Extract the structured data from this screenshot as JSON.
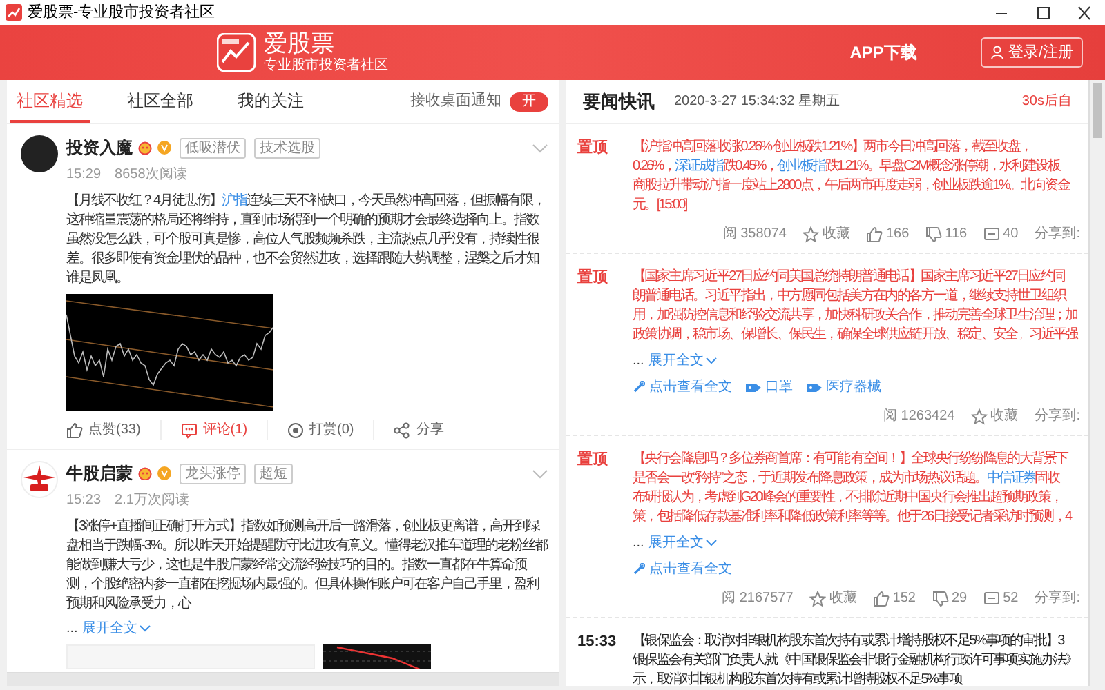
{
  "window": {
    "title": "爱股票-专业股市投资者社区"
  },
  "header": {
    "brand": "爱股票",
    "tagline": "专业股市投资者社区",
    "app_download": "APP下载",
    "login_button": "登录/注册"
  },
  "community": {
    "tabs": [
      {
        "label": "社区精选",
        "selected": true
      },
      {
        "label": "社区全部",
        "selected": false
      },
      {
        "label": "我的关注",
        "selected": false
      }
    ],
    "notify_label": "接收桌面通知",
    "notify_toggle": {
      "label": "开",
      "on": true
    }
  },
  "posts": [
    {
      "author": "投资入魔",
      "avatar": {
        "kind": "photo"
      },
      "tags": [
        "低吸潜伏",
        "技术选股"
      ],
      "time": "15:29",
      "reads": "8658次阅读",
      "text": [
        {
          "text": "【月线不收红？4月徒悲伤】",
          "link": false
        },
        {
          "text": "沪指",
          "link": true
        },
        {
          "text": "连续三天不补缺口，今天虽然冲高回落，但振幅有限，这种缩量震荡的格局还将维持，直到市场得到一个明确的预期才会最终选择向上。指数虽然没怎么跌，可个股可真是惨，高位人气股频频杀跌，主流热点几乎没有，持续性很差。很多即使有资金埋伏的品种，也不会贸然进攻，选择跟随大势调整，涅槃之后才知谁是凤凰。",
          "link": false
        }
      ],
      "media": [
        {
          "kind": "chart"
        }
      ],
      "actions": [
        {
          "kind": "like",
          "label": "点赞(33)",
          "active": false
        },
        {
          "kind": "comment",
          "label": "评论(1)",
          "active": true
        },
        {
          "kind": "reward",
          "label": "打赏(0)",
          "active": false
        },
        {
          "kind": "share",
          "label": "分享",
          "active": false
        }
      ]
    },
    {
      "author": "牛股启蒙",
      "avatar": {
        "kind": "logo"
      },
      "tags": [
        "龙头涨停",
        "超短"
      ],
      "time": "15:23",
      "reads": "2.1万次阅读",
      "text": [
        {
          "text": "【3涨停+直播间正确打开方式】指数如预测高开后一路滑落，创业板更离谱，高开到绿盘相当于跌幅-3%。所以昨天开始提醒防守比进攻有意义。懂得老汉推车道理的老粉丝都能做到赚大亏少，这也是牛股启蒙经常交流经验技巧的目的。指数一直都在牛算命预测，个股绝密内参一直都在挖掘场内最强的。但具体操作账户可在客户自己手里，盈利预期和风险承受力，心",
          "link": false
        }
      ],
      "ellipsis": "...",
      "expand": "展开全文",
      "media": [
        {
          "kind": "screenshot"
        },
        {
          "kind": "chart_thumb"
        }
      ]
    }
  ],
  "news": {
    "title": "要闻快讯",
    "datetime": "2020-3-27 15:34:32 星期五",
    "refresh": "30s后自",
    "items": [
      {
        "badge": "置顶",
        "pinned": true,
        "lines": [
          [
            {
              "text": "【沪指冲高回落收涨0.26% 创业板跌1.21%】两市今日冲高回落，截至收盘，",
              "link": false
            }
          ],
          [
            {
              "text": "0.26%，",
              "link": false
            },
            {
              "text": "深证成指",
              "link": true
            },
            {
              "text": "跌0.45%，",
              "link": false
            },
            {
              "text": "创业板指",
              "link": true
            },
            {
              "text": "跌1.21%。早盘C2M概念涨停潮，水利建设板",
              "link": false
            }
          ],
          [
            {
              "text": "商股拉升带动沪指一度站上2800点，午后两市再度走弱，创业板跌逾1%。北向资金",
              "link": false
            }
          ],
          [
            {
              "text": "元。[15:00]",
              "link": false
            }
          ]
        ],
        "stats": [
          {
            "kind": "views",
            "label": "阅 358074"
          },
          {
            "kind": "favorite",
            "label": "收藏"
          },
          {
            "kind": "like",
            "label": "166"
          },
          {
            "kind": "dislike",
            "label": "116"
          },
          {
            "kind": "comment",
            "label": "40"
          },
          {
            "kind": "share",
            "label": "分享到:"
          }
        ]
      },
      {
        "badge": "置顶",
        "pinned": true,
        "lines": [
          [
            {
              "text": "【国家主席习近平27日应约同美国总统特朗普通电话】国家主席习近平27日应约同",
              "link": false
            }
          ],
          [
            {
              "text": "朗普通电话。习近平指出，中方愿同包括美方在内的各方一道，继续支持世卫组织",
              "link": false
            }
          ],
          [
            {
              "text": "用，加强防控信息和经验交流共享，加快科研攻关合作，推动完善全球卫生治理；加",
              "link": false
            }
          ],
          [
            {
              "text": "政策协调，稳市场、保增长、保民生，确保全球供应链开放、稳定、安全。习近平强",
              "link": false
            }
          ]
        ],
        "ellipsis": "...",
        "expand": "展开全文",
        "links": [
          {
            "kind": "full",
            "label": "点击查看全文"
          },
          {
            "kind": "tag",
            "label": "口罩"
          },
          {
            "kind": "tag",
            "label": "医疗器械"
          }
        ],
        "stats": [
          {
            "kind": "views",
            "label": "阅 1263424"
          },
          {
            "kind": "favorite",
            "label": "收藏"
          },
          {
            "kind": "share",
            "label": "分享到:"
          }
        ]
      },
      {
        "badge": "置顶",
        "pinned": true,
        "lines": [
          [
            {
              "text": "【央行会降息吗？多位券商首席：有可能 有空间！】全球央行纷纷降息的大背景下",
              "link": false
            }
          ],
          [
            {
              "text": "是否会一改“矜持”之态，于近期发布降息政策，成为市场热议话题。",
              "link": false
            },
            {
              "text": "中信证券",
              "link": true
            },
            {
              "text": "固收",
              "link": false
            }
          ],
          [
            {
              "text": "布研报认为，考虑到G20峰会的重要性，不排除近期中国央行会推出超预期政策，",
              "link": false
            }
          ],
          [
            {
              "text": "策，包括降低存款基准利率和降低政策利率等等。他于26日接受记者采访时预测，4",
              "link": false
            }
          ]
        ],
        "ellipsis": "...",
        "expand": "展开全文",
        "links": [
          {
            "kind": "full",
            "label": "点击查看全文"
          }
        ],
        "stats": [
          {
            "kind": "views",
            "label": "阅 2167577"
          },
          {
            "kind": "favorite",
            "label": "收藏"
          },
          {
            "kind": "like",
            "label": "152"
          },
          {
            "kind": "dislike",
            "label": "29"
          },
          {
            "kind": "comment",
            "label": "52"
          },
          {
            "kind": "share",
            "label": "分享到:"
          }
        ]
      },
      {
        "badge": "15:33",
        "pinned": false,
        "lines": [
          [
            {
              "text": "【银保监会：取消对非银机构股东首次持有或累计增持股权不足5%事项的审批】3",
              "link": false
            }
          ],
          [
            {
              "text": "银保监会有关部门负责人就《中国银保监会非银行金融机构行政许可事项实施办法》",
              "link": false
            }
          ],
          [
            {
              "text": "示，取消对非银机构股东首次持有或累计增持股权不足5%事项",
              "link": false
            }
          ]
        ]
      }
    ]
  }
}
